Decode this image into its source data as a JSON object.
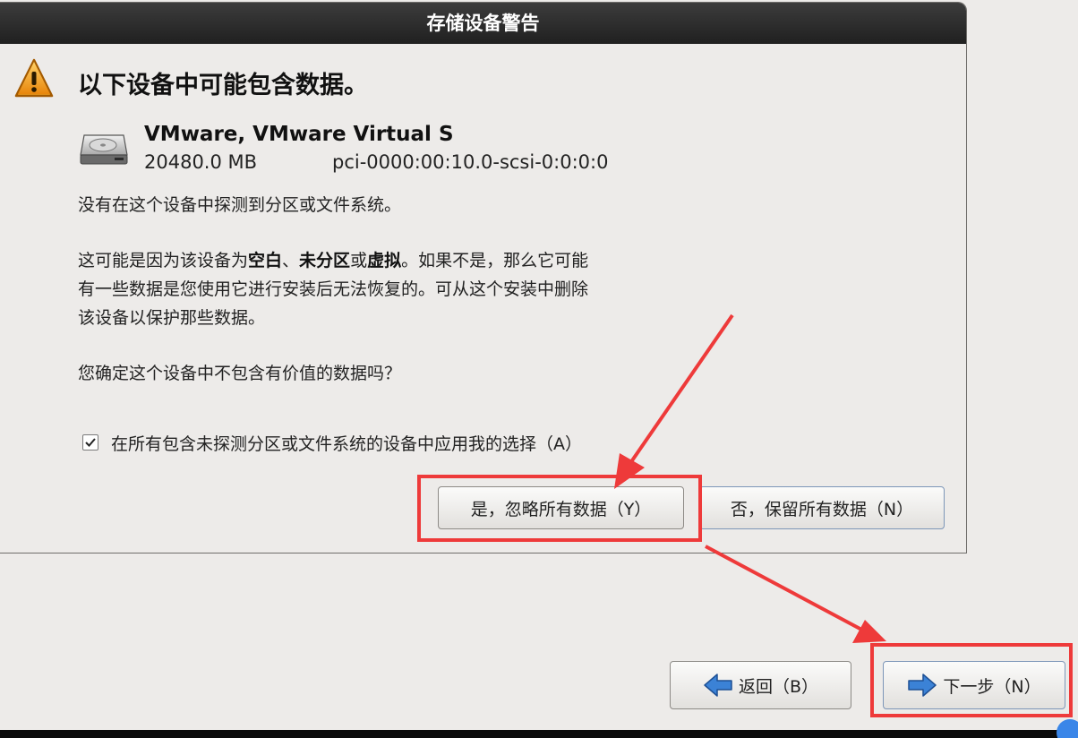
{
  "dialog": {
    "title": "存储设备警告",
    "headline": "以下设备中可能包含数据。",
    "device": {
      "name": "VMware, VMware Virtual S",
      "size": "20480.0 MB",
      "path": "pci-0000:00:10.0-scsi-0:0:0:0"
    },
    "message1": "没有在这个设备中探测到分区或文件系统。",
    "message2": {
      "line1_prefix": "这可能是因为该设备为",
      "bold1": "空白",
      "sep1": "、",
      "bold2": "未分区",
      "sep2": "或",
      "bold3": "虚拟",
      "line1_suffix": "。如果不是，那么它可能",
      "line2": "有一些数据是您使用它进行安装后无法恢复的。可从这个安装中删除",
      "line3": "该设备以保护那些数据。"
    },
    "question": "您确定这个设备中不包含有价值的数据吗？",
    "checkbox": {
      "label": "在所有包含未探测分区或文件系统的设备中应用我的选择（A）",
      "checked": true
    },
    "yes_button": "是，忽略所有数据（Y）",
    "no_button": "否，保留所有数据（N）"
  },
  "nav": {
    "back_button": "返回（B）",
    "next_button": "下一步（N）"
  },
  "colors": {
    "highlight": "#ee3a3a",
    "titlebar": "#2a2a2a",
    "arrow_icon": "#2d6fc4"
  },
  "icons": {
    "warning": "warning-triangle-icon",
    "disk": "hard-disk-icon",
    "back": "arrow-left-icon",
    "next": "arrow-right-icon"
  }
}
